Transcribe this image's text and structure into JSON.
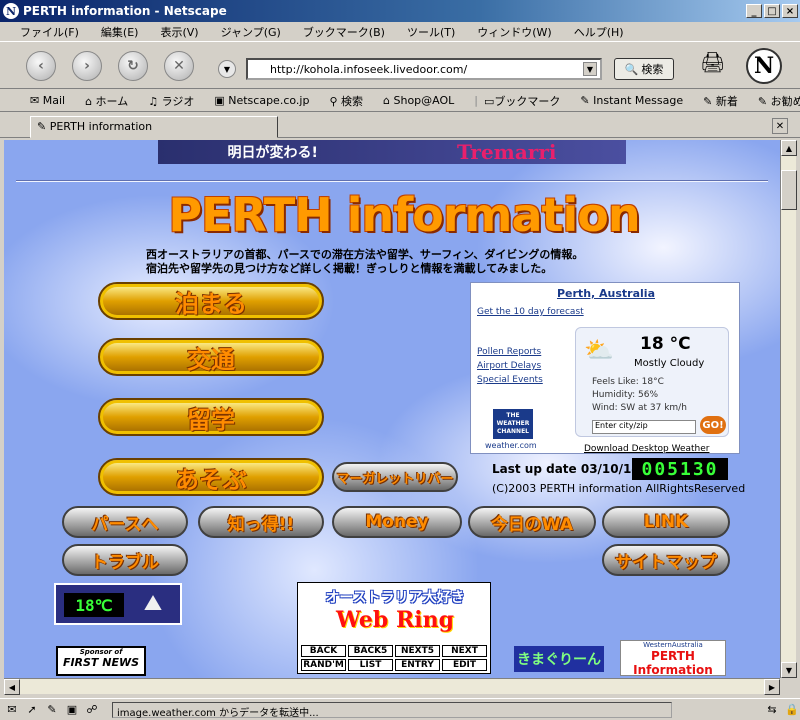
{
  "window": {
    "title": "PERTH  information - Netscape"
  },
  "menu": [
    "ファイル(F)",
    "編集(E)",
    "表示(V)",
    "ジャンプ(G)",
    "ブックマーク(B)",
    "ツール(T)",
    "ウィンドウ(W)",
    "ヘルプ(H)"
  ],
  "nav": {
    "url": "http://kohola.infoseek.livedoor.com/",
    "search_label": "検索"
  },
  "bookmarks": [
    "Mail",
    "ホーム",
    "ラジオ",
    "Netscape.co.jp",
    "検索",
    "Shop@AOL",
    "ブックマーク",
    "Instant Message",
    "新着",
    "お勧め"
  ],
  "tab": {
    "label": "PERTH  information"
  },
  "page": {
    "banner": {
      "left": "明日が変わる!",
      "right": "Tremarri"
    },
    "logo": "PERTH information",
    "description_1": "西オーストラリアの首都、パースでの滞在方法や留学、サーフィン、ダイビングの情報。",
    "description_2": "宿泊先や留学先の見つけ方など詳しく掲載！ぎっしりと情報を満載してみました。",
    "main_buttons": [
      "泊まる",
      "交通",
      "留学",
      "あそぶ"
    ],
    "margaret_button": "マーガレットリバー",
    "pill_buttons_row1": [
      "パースへ",
      "知っ得!!",
      "Money",
      "今日のWA",
      "LINK"
    ],
    "trouble_button": "トラブル",
    "sitemap_button": "サイトマップ",
    "last_update": "Last up date 03/10/14",
    "counter": "005130",
    "copyright": "(C)2003 PERTH information AllRightsReserved",
    "thermo_value": "18℃"
  },
  "weather": {
    "city": "Perth, Australia",
    "ten_day": "Get the 10 day forecast",
    "links": [
      "Pollen Reports",
      "Airport Delays",
      "Special Events"
    ],
    "temp": "18 °C",
    "condition": "Mostly Cloudy",
    "feels_like": "Feels Like: 18°C",
    "humidity": "Humidity: 56%",
    "wind": "Wind: SW at 37 km/h",
    "city_placeholder": "Enter city/zip",
    "go": "GO!",
    "twc_logo": "THE WEATHER CHANNEL",
    "twc_url": "weather.com",
    "download": "Download Desktop Weather"
  },
  "webring": {
    "title1": "オーストラリア大好き",
    "title2": "Web Ring",
    "buttons": [
      "BACK",
      "BACK5",
      "NEXT5",
      "NEXT",
      "RAND'M",
      "LIST",
      "ENTRY",
      "EDIT"
    ]
  },
  "sponsor": {
    "line1": "Sponsor of",
    "line2": "FIRST NEWS"
  },
  "kimagure": "きまぐりーん",
  "waperth": {
    "line1": "WesternAustralia",
    "line2": "PERTH Information"
  },
  "status": {
    "message": "image.weather.com からデータを転送中..."
  }
}
